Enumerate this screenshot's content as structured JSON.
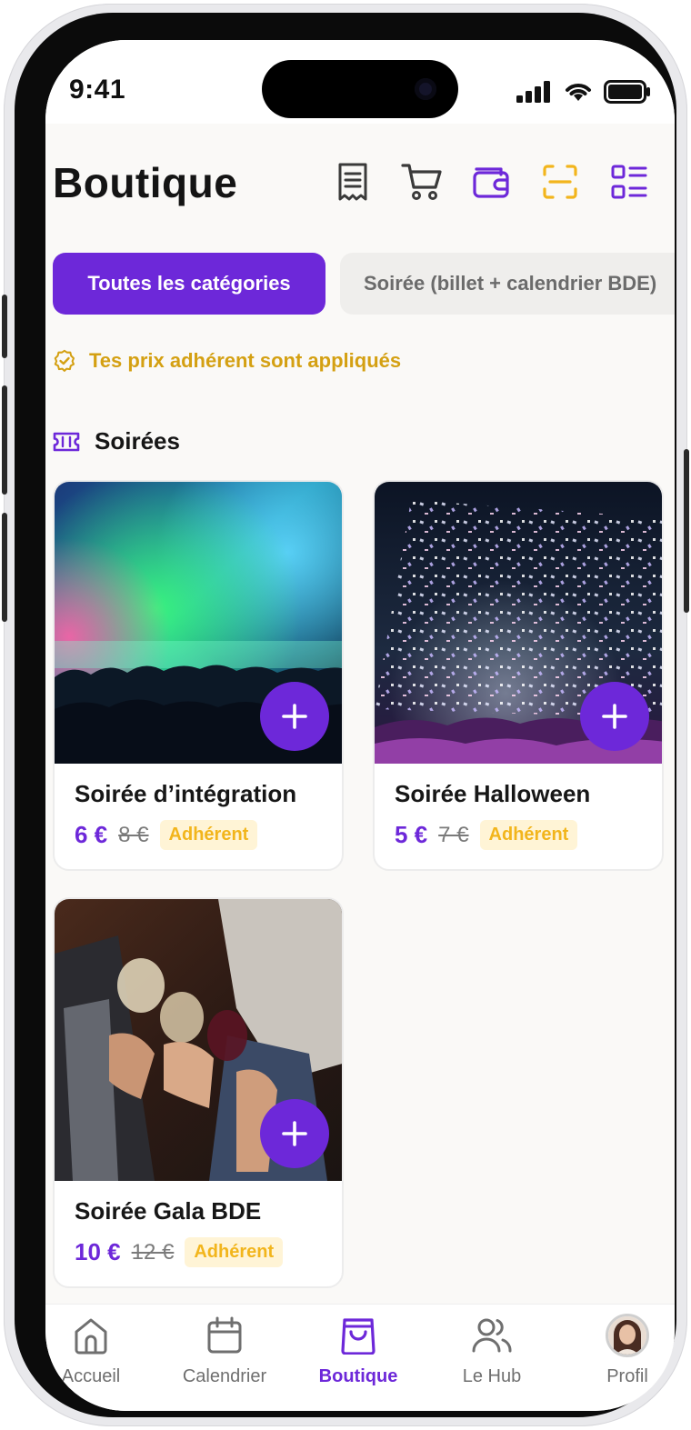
{
  "status_bar": {
    "time": "9:41"
  },
  "header": {
    "title": "Boutique"
  },
  "categories": [
    {
      "label": "Toutes les catégories",
      "active": true
    },
    {
      "label": "Soirée (billet + calendrier BDE)",
      "active": false
    }
  ],
  "notice": {
    "text": "Tes prix adhérent sont appliqués"
  },
  "section": {
    "title": "Soirées"
  },
  "products": [
    {
      "name": "Soirée d’intégration",
      "price": "6 €",
      "old_price": "8 €",
      "badge": "Adhérent"
    },
    {
      "name": "Soirée Halloween",
      "price": "5 €",
      "old_price": "7 €",
      "badge": "Adhérent"
    },
    {
      "name": "Soirée Gala BDE",
      "price": "10 €",
      "old_price": "12 €",
      "badge": "Adhérent"
    }
  ],
  "tabs": [
    {
      "label": "Accueil",
      "icon": "home-icon"
    },
    {
      "label": "Calendrier",
      "icon": "calendar-icon"
    },
    {
      "label": "Boutique",
      "icon": "shopping-bag-icon",
      "active": true
    },
    {
      "label": "Le Hub",
      "icon": "users-icon"
    },
    {
      "label": "Profil",
      "icon": "avatar"
    }
  ],
  "colors": {
    "accent": "#6d28d9",
    "notice": "#d4a012",
    "badge_text": "#f2b51c",
    "badge_bg": "#fff4d6"
  }
}
